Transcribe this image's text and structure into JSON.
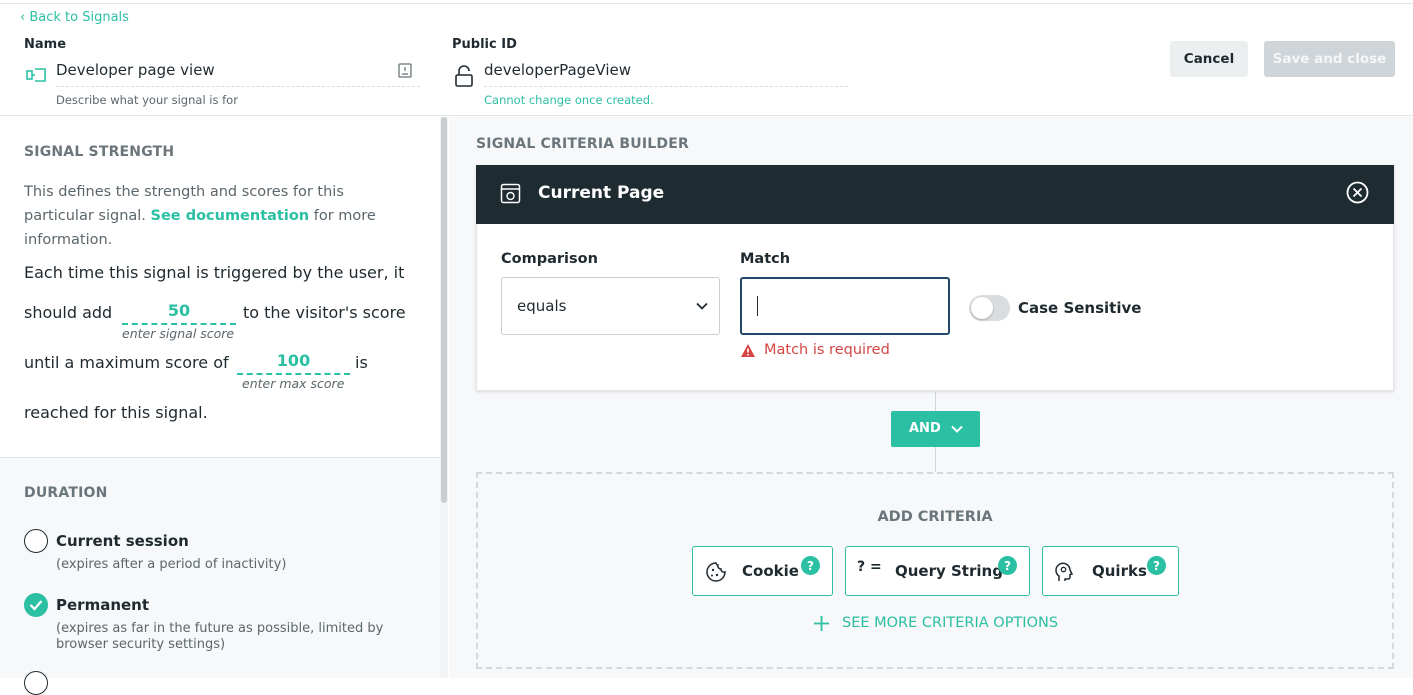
{
  "header": {
    "back_link": "Back to Signals",
    "name_label": "Name",
    "name_value": "Developer page view",
    "name_hint": "Describe what your signal is for",
    "public_id_label": "Public ID",
    "public_id_value": "developerPageView",
    "public_id_hint": "Cannot change once created.",
    "cancel_label": "Cancel",
    "save_label": "Save and close"
  },
  "strength": {
    "title": "SIGNAL STRENGTH",
    "desc_pre": "This defines the strength and scores for this particular signal.",
    "doc_link": "See documentation",
    "desc_post": "for more information.",
    "line1": "Each time this signal is triggered by the user, it",
    "line2_pre": "should add",
    "signal_score": "50",
    "line2_post": "to the visitor's score",
    "signal_score_hint": "enter signal score",
    "line3_pre": "until a maximum score of",
    "max_score": "100",
    "line3_post": "is",
    "max_score_hint": "enter max score",
    "line4": "reached for this signal."
  },
  "duration": {
    "title": "DURATION",
    "options": [
      {
        "label": "Current session",
        "hint": "(expires after a period of inactivity)",
        "selected": false
      },
      {
        "label": "Permanent",
        "hint": "(expires as far in the future as possible, limited by browser security settings)",
        "selected": true
      }
    ]
  },
  "builder": {
    "title": "SIGNAL CRITERIA BUILDER",
    "card_title": "Current Page",
    "comparison_label": "Comparison",
    "comparison_value": "equals",
    "match_label": "Match",
    "match_value": "",
    "match_error": "Match is required",
    "case_sensitive_label": "Case Sensitive",
    "case_sensitive": false,
    "operator": "AND",
    "add_title": "ADD CRITERIA",
    "chips": [
      {
        "label": "Cookie",
        "icon": "cookie-icon"
      },
      {
        "label": "Query String",
        "icon": "query-string-icon",
        "glyph": "? ="
      },
      {
        "label": "Quirks",
        "icon": "head-icon"
      }
    ],
    "help_glyph": "?",
    "see_more": "SEE MORE CRITERIA OPTIONS"
  },
  "colors": {
    "accent": "#2bbfa4",
    "dark_header": "#1e2b31",
    "error": "#d64545",
    "focus": "#23486b"
  }
}
